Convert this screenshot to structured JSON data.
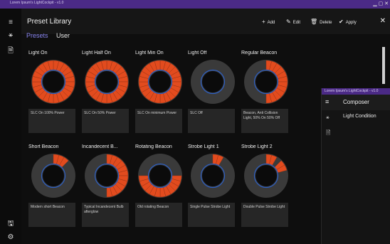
{
  "window": {
    "title": "Lorem Ipsum's LightCockpit - v1.0"
  },
  "sidebar": {
    "icons": [
      "menu-icon",
      "preset-icon",
      "document-icon",
      "save-icon",
      "settings-icon"
    ]
  },
  "header": {
    "title": "Preset Library",
    "actions": [
      {
        "icon": "+",
        "label": "Add"
      },
      {
        "icon": "✎",
        "label": "Edit"
      },
      {
        "icon": "🗑",
        "label": "Delete"
      },
      {
        "icon": "✔",
        "label": "Apply"
      }
    ]
  },
  "tabs": [
    {
      "label": "Presets",
      "active": true
    },
    {
      "label": "User",
      "active": false
    }
  ],
  "colors": {
    "accent": "#8a86f0",
    "segment": "#e24b1e",
    "ring": "#3a3a3a",
    "inner": "#2c5fc4"
  },
  "presets": [
    {
      "name": "Light On",
      "desc": "SLC On 100% Power",
      "segments": [
        0,
        1,
        2,
        3,
        4,
        5,
        6,
        7,
        8,
        9,
        10,
        11,
        12,
        13,
        14,
        15,
        16,
        17,
        18,
        19,
        20,
        21,
        22,
        23
      ]
    },
    {
      "name": "Light Half On",
      "desc": "SLC On 50% Power",
      "segments": [
        0,
        1,
        2,
        3,
        4,
        5,
        6,
        7,
        8,
        9,
        10,
        11,
        12,
        13,
        14,
        15,
        16,
        17,
        18,
        19,
        20,
        21,
        22,
        23
      ]
    },
    {
      "name": "Light Min On",
      "desc": "SLC On minimum Power",
      "segments": [
        0,
        1,
        2,
        3,
        4,
        5,
        6,
        7,
        8,
        9,
        10,
        11,
        12,
        13,
        14,
        15,
        16,
        17,
        18,
        19,
        20,
        21,
        22,
        23
      ]
    },
    {
      "name": "Light Off",
      "desc": "SLC Off",
      "segments": []
    },
    {
      "name": "Regular Beacon",
      "desc": "Beacon, Anti Collision Light, 50% On 50% Off",
      "segments": [
        0,
        1,
        2,
        3,
        4,
        5,
        6,
        7,
        8,
        9,
        10,
        11
      ]
    },
    {
      "name": "Short Beacon",
      "desc": "Modern short Beacon",
      "segments": [
        0,
        1,
        2
      ]
    },
    {
      "name": "Incandecent B...",
      "desc": "Typical Incandecent Bulb afterglow",
      "segments": [
        0,
        1,
        2,
        3,
        4,
        5,
        6,
        7,
        8,
        9,
        10,
        11
      ]
    },
    {
      "name": "Rotating Beacon",
      "desc": "Old rotating Beacon",
      "segments": [
        6,
        7,
        8,
        9,
        10,
        11,
        12,
        13,
        14,
        15,
        16,
        17
      ]
    },
    {
      "name": "Strobe Light 1",
      "desc": "Single Pulse Strobe Light",
      "segments": [
        0,
        1
      ]
    },
    {
      "name": "Strobe Light 2",
      "desc": "Double Pulse Strobe Light",
      "segments": [
        0,
        1,
        3,
        4
      ]
    }
  ],
  "composer": {
    "window_title": "Lorem Ipsum's LightCockpit - v1.0",
    "title": "Composer",
    "item": "Light Condition"
  }
}
